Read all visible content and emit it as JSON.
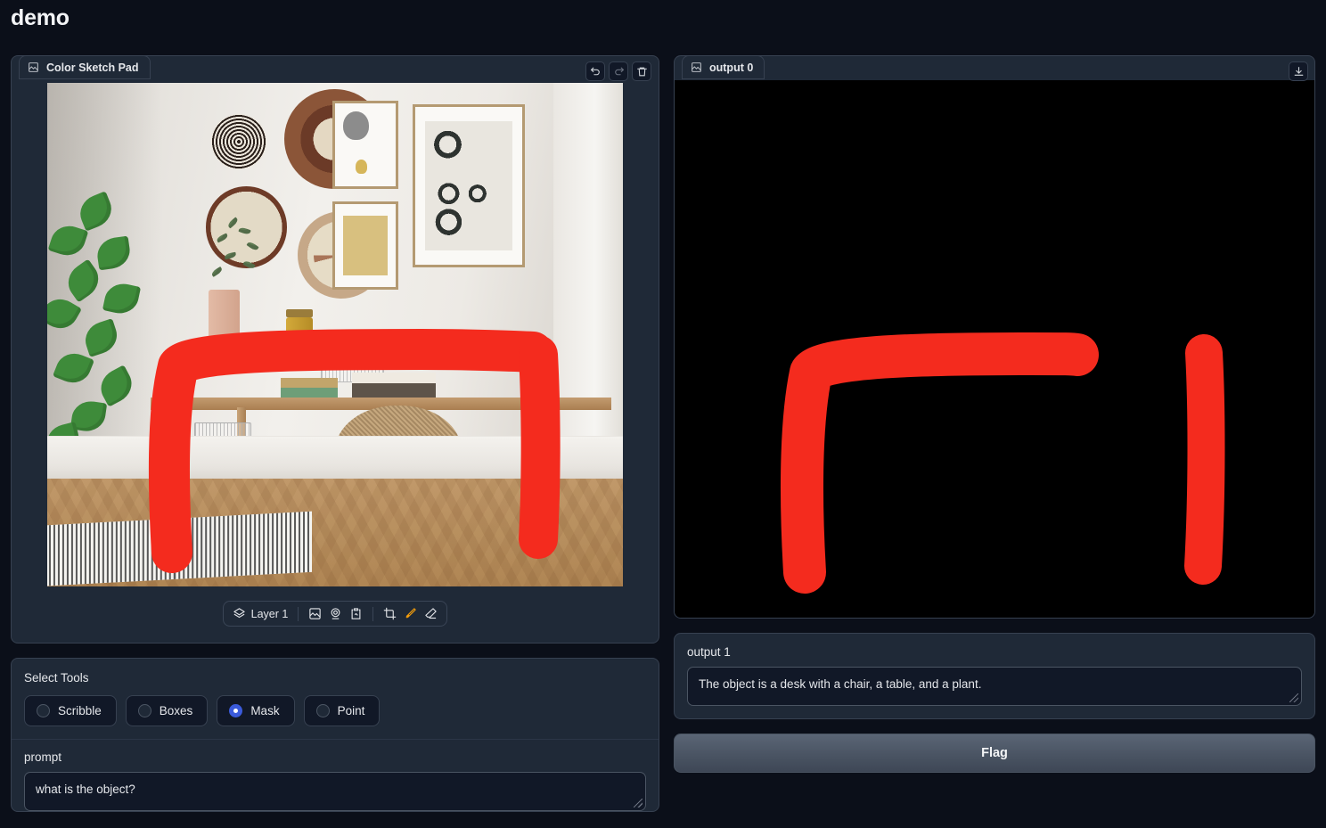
{
  "app": {
    "title": "demo"
  },
  "sketch": {
    "tab_label": "Color Sketch Pad",
    "tab_icon": "image-icon",
    "toolbar": [
      {
        "name": "undo-button",
        "icon": "undo-icon"
      },
      {
        "name": "redo-button",
        "icon": "redo-icon"
      },
      {
        "name": "clear-button",
        "icon": "trash-icon"
      }
    ],
    "layer_bar": {
      "layers_icon": "layers-icon",
      "layer_label": "Layer 1",
      "tools": [
        {
          "name": "upload-image-button",
          "icon": "image-upload-icon",
          "active": false
        },
        {
          "name": "webcam-button",
          "icon": "webcam-icon",
          "active": false
        },
        {
          "name": "paste-image-button",
          "icon": "clipboard-image-icon",
          "active": false
        },
        {
          "name": "crop-button",
          "icon": "crop-icon",
          "active": false
        },
        {
          "name": "brush-button",
          "icon": "pen-brush-icon",
          "active": true
        },
        {
          "name": "eraser-button",
          "icon": "eraser-icon",
          "active": false
        }
      ]
    },
    "image": {
      "description": "Interior room photo: woven wall baskets, framed abstract art, potted plant, white desk with pedestal drawer, tan upholstered chair, herringbone wood floor, woven rug",
      "annotation_color": "#F42B1E"
    }
  },
  "tools": {
    "label": "Select Tools",
    "options": [
      {
        "label": "Scribble",
        "selected": false
      },
      {
        "label": "Boxes",
        "selected": false
      },
      {
        "label": "Mask",
        "selected": true
      },
      {
        "label": "Point",
        "selected": false
      }
    ],
    "selected_value": "Mask",
    "accent_color": "#3B5BDB"
  },
  "prompt": {
    "label": "prompt",
    "value": "what is the object?",
    "placeholder": ""
  },
  "output0": {
    "tab_label": "output 0",
    "tab_icon": "image-icon",
    "download_icon": "download-icon",
    "canvas_background": "#000000",
    "mask_color": "#F42B1E",
    "description": "Binary mask image: red brush strokes on black background"
  },
  "output1": {
    "label": "output 1",
    "value": "The object is a desk with a chair, a table, and a plant."
  },
  "flag": {
    "label": "Flag"
  }
}
